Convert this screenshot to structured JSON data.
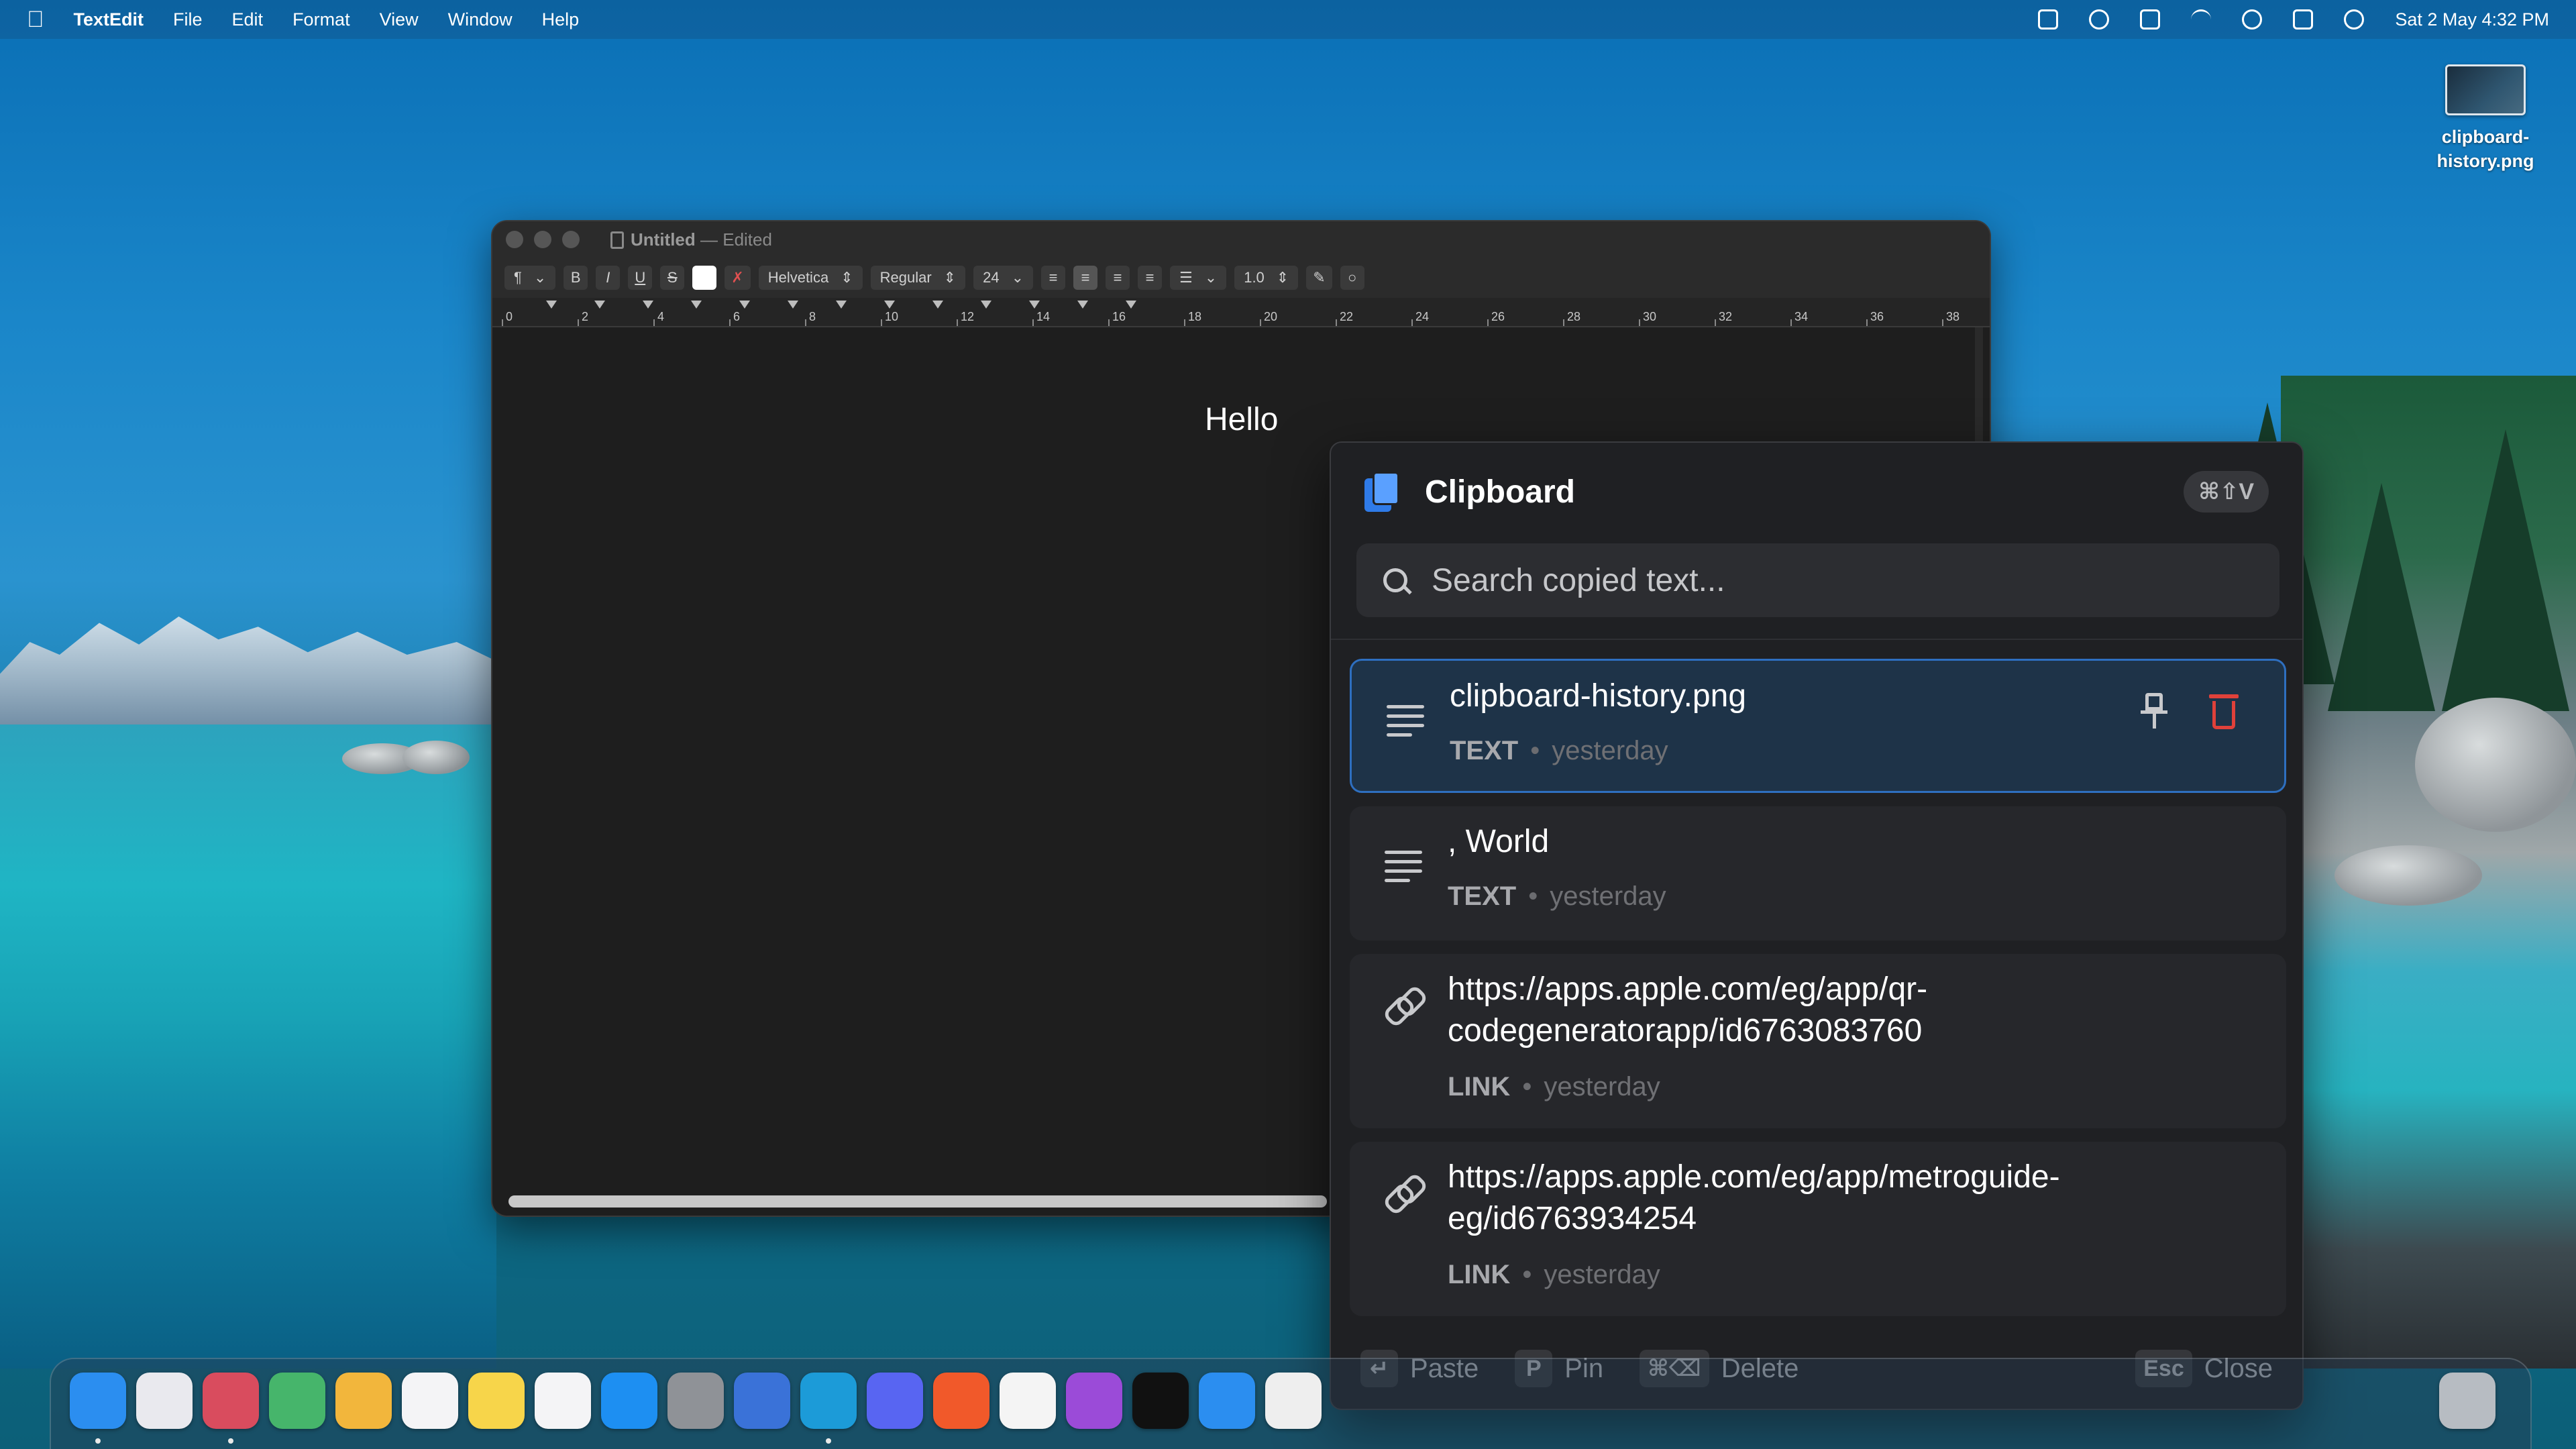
{
  "menubar": {
    "apple": "",
    "app_name": "TextEdit",
    "menus": [
      "File",
      "Edit",
      "Format",
      "View",
      "Window",
      "Help"
    ],
    "datetime": "Sat 2 May  4:32 PM"
  },
  "desktop": {
    "file_label": "clipboard-history.png"
  },
  "textedit": {
    "title": "Untitled",
    "subtitle": "— Edited",
    "toolbar": {
      "paragraph": "¶",
      "bold": "B",
      "italic": "I",
      "underline": "U",
      "strike": "S",
      "font": "Helvetica",
      "style": "Regular",
      "size": "24",
      "spacing": "1.0"
    },
    "ruler_numbers": [
      "0",
      "2",
      "4",
      "6",
      "8",
      "10",
      "12",
      "14",
      "16",
      "18",
      "20",
      "22",
      "24",
      "26",
      "28",
      "30",
      "32",
      "34",
      "36",
      "38"
    ],
    "document_text": "Hello"
  },
  "clipboard": {
    "title": "Clipboard",
    "shortcut": "⌘⇧V",
    "search_placeholder": "Search copied text...",
    "items": [
      {
        "title": "clipboard-history.png",
        "kind": "TEXT",
        "when": "yesterday",
        "icon": "text-lines-icon",
        "selected": true
      },
      {
        "title": ", World",
        "kind": "TEXT",
        "when": "yesterday",
        "icon": "text-lines-icon",
        "selected": false
      },
      {
        "title_line1": "https://apps.apple.com/eg/app/qr-",
        "title_line2": "codegeneratorapp/id6763083760",
        "kind": "LINK",
        "when": "yesterday",
        "icon": "link-icon",
        "selected": false
      },
      {
        "title_line1": "https://apps.apple.com/eg/app/metroguide-",
        "title_line2": "eg/id6763934254",
        "kind": "LINK",
        "when": "yesterday",
        "icon": "link-icon",
        "selected": false
      }
    ],
    "footer": {
      "paste_key": "↵",
      "paste_label": "Paste",
      "pin_key": "P",
      "pin_label": "Pin",
      "delete_key": "⌘⌫",
      "delete_label": "Delete",
      "close_key": "Esc",
      "close_label": "Close"
    }
  },
  "dock": {
    "apps": [
      {
        "name": "finder-icon",
        "color": "#2b8ef0"
      },
      {
        "name": "launchpad-icon",
        "color": "#e9e9ee"
      },
      {
        "name": "vectornator-icon",
        "color": "#d94c5e"
      },
      {
        "name": "maps-icon",
        "color": "#46b56b"
      },
      {
        "name": "photos-icon",
        "color": "#f2b63c"
      },
      {
        "name": "reminders-icon",
        "color": "#f4f4f6"
      },
      {
        "name": "notes-icon",
        "color": "#f7d54a"
      },
      {
        "name": "freeform-icon",
        "color": "#f4f4f6"
      },
      {
        "name": "app-store-icon",
        "color": "#1d8ff2"
      },
      {
        "name": "system-settings-icon",
        "color": "#8f9297"
      },
      {
        "name": "simulator-icon",
        "color": "#3a72d8"
      },
      {
        "name": "edge-icon",
        "color": "#1c9bd8"
      },
      {
        "name": "discord-icon",
        "color": "#5865f2"
      },
      {
        "name": "swift-playgrounds-icon",
        "color": "#f1592a"
      },
      {
        "name": "notion-icon",
        "color": "#f4f4f4"
      },
      {
        "name": "podcasts-icon",
        "color": "#9b4bd8"
      },
      {
        "name": "unity-icon",
        "color": "#111111"
      },
      {
        "name": "xcode-instruments-icon",
        "color": "#2b8ef0"
      },
      {
        "name": "word-icon",
        "color": "#eeeeee"
      },
      {
        "name": "trash-icon",
        "color": "#b7bcc2"
      }
    ]
  }
}
